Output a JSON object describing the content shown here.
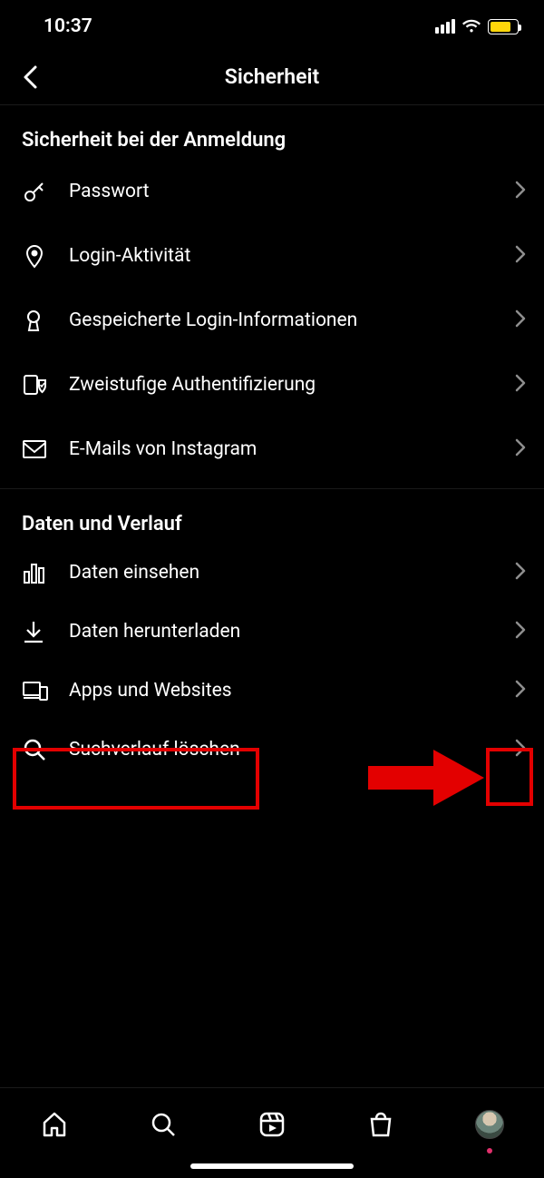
{
  "status": {
    "time": "10:37"
  },
  "header": {
    "title": "Sicherheit"
  },
  "sections": {
    "login": {
      "title": "Sicherheit bei der Anmeldung",
      "items": [
        {
          "label": "Passwort"
        },
        {
          "label": "Login-Aktivität"
        },
        {
          "label": "Gespeicherte Login-Informationen"
        },
        {
          "label": "Zweistufige Authentifizierung"
        },
        {
          "label": "E-Mails von Instagram"
        }
      ]
    },
    "data": {
      "title": "Daten und Verlauf",
      "items": [
        {
          "label": "Daten einsehen"
        },
        {
          "label": "Daten herunterladen"
        },
        {
          "label": "Apps und Websites"
        },
        {
          "label": "Suchverlauf löschen"
        }
      ]
    }
  }
}
